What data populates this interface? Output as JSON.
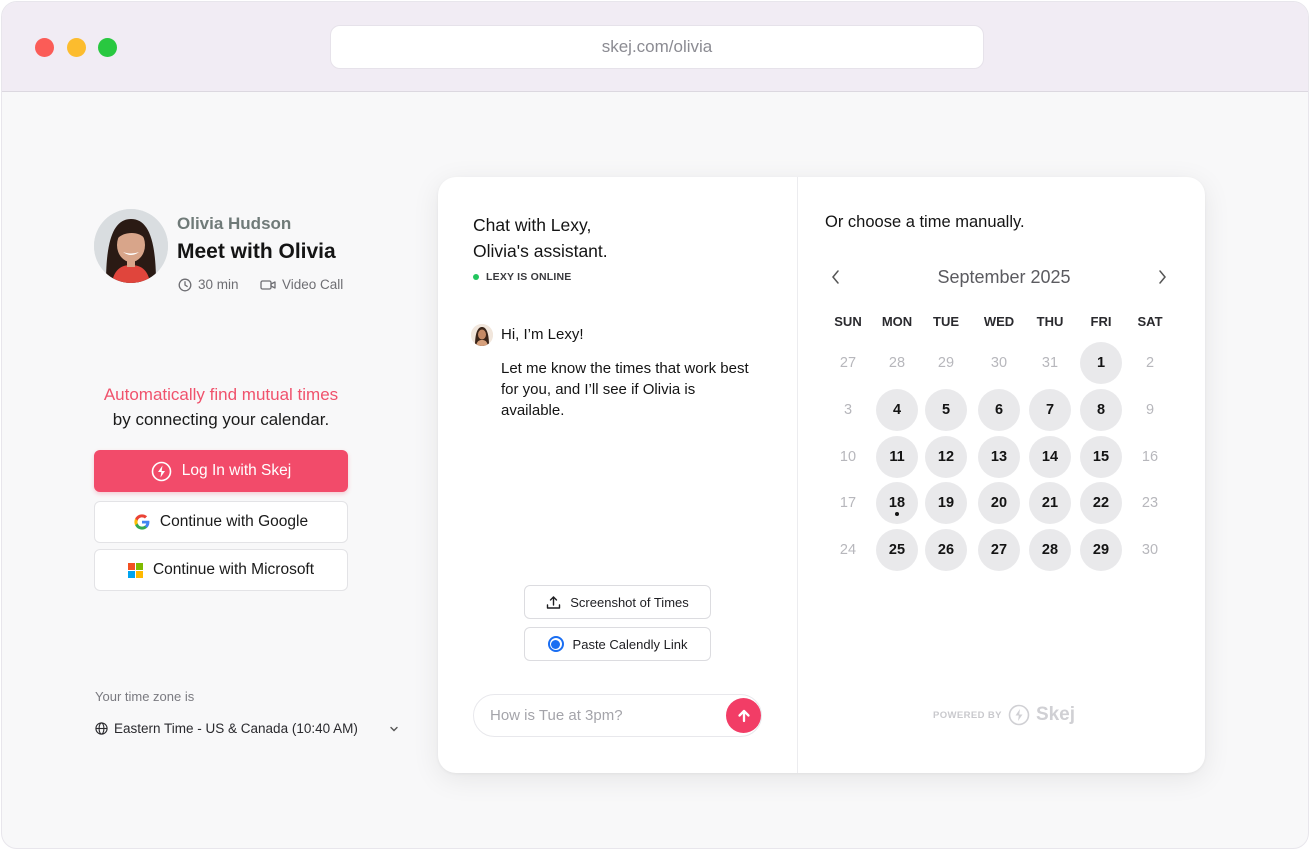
{
  "browser": {
    "url": "skej.com/olivia"
  },
  "profile": {
    "host_name": "Olivia Hudson",
    "meeting_title": "Meet with Olivia",
    "duration": "30 min",
    "call_type": "Video Call"
  },
  "connect": {
    "line1": "Automatically find mutual times",
    "line2": "by connecting your calendar.",
    "skej_button": "Log In with Skej",
    "google_button": "Continue with Google",
    "microsoft_button": "Continue with Microsoft"
  },
  "timezone": {
    "label": "Your time zone is",
    "value": "Eastern Time - US & Canada (10:40 AM)"
  },
  "chat": {
    "title_line1": "Chat with Lexy,",
    "title_line2": "Olivia's assistant.",
    "status": "LEXY IS ONLINE",
    "greeting": "Hi, I’m Lexy!",
    "message": "Let me know the times that work best for you, and I’ll see if Olivia is available.",
    "screenshot_button": "Screenshot of Times",
    "paste_button": "Paste Calendly Link",
    "input_placeholder": "How is Tue at 3pm?"
  },
  "calendar": {
    "heading": "Or choose a time manually.",
    "month": "September 2025",
    "weekdays": [
      "SUN",
      "MON",
      "TUE",
      "WED",
      "THU",
      "FRI",
      "SAT"
    ],
    "weeks": [
      [
        {
          "d": "27",
          "s": "muted"
        },
        {
          "d": "28",
          "s": "muted"
        },
        {
          "d": "29",
          "s": "muted"
        },
        {
          "d": "30",
          "s": "muted"
        },
        {
          "d": "31",
          "s": "muted"
        },
        {
          "d": "1",
          "s": "avail"
        },
        {
          "d": "2",
          "s": "muted"
        }
      ],
      [
        {
          "d": "3",
          "s": "muted"
        },
        {
          "d": "4",
          "s": "avail"
        },
        {
          "d": "5",
          "s": "avail"
        },
        {
          "d": "6",
          "s": "avail"
        },
        {
          "d": "7",
          "s": "avail"
        },
        {
          "d": "8",
          "s": "avail"
        },
        {
          "d": "9",
          "s": "muted"
        }
      ],
      [
        {
          "d": "10",
          "s": "muted"
        },
        {
          "d": "11",
          "s": "avail"
        },
        {
          "d": "12",
          "s": "avail"
        },
        {
          "d": "13",
          "s": "avail"
        },
        {
          "d": "14",
          "s": "avail"
        },
        {
          "d": "15",
          "s": "avail"
        },
        {
          "d": "16",
          "s": "muted"
        }
      ],
      [
        {
          "d": "17",
          "s": "muted"
        },
        {
          "d": "18",
          "s": "today"
        },
        {
          "d": "19",
          "s": "avail"
        },
        {
          "d": "20",
          "s": "avail"
        },
        {
          "d": "21",
          "s": "avail"
        },
        {
          "d": "22",
          "s": "avail"
        },
        {
          "d": "23",
          "s": "muted"
        }
      ],
      [
        {
          "d": "24",
          "s": "muted"
        },
        {
          "d": "25",
          "s": "avail"
        },
        {
          "d": "26",
          "s": "avail"
        },
        {
          "d": "27",
          "s": "avail"
        },
        {
          "d": "28",
          "s": "avail"
        },
        {
          "d": "29",
          "s": "avail"
        },
        {
          "d": "30",
          "s": "muted"
        }
      ]
    ],
    "powered_by": "POWERED BY",
    "brand": "Skej"
  },
  "colors": {
    "accent": "#f24b6a",
    "online": "#22c55e",
    "available_day": "#e9e9eb"
  }
}
